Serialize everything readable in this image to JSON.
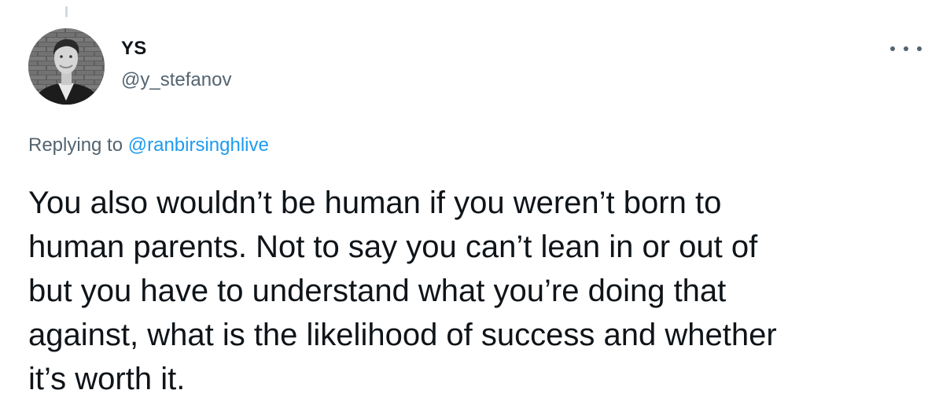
{
  "author": {
    "display_name": "YS",
    "handle": "@y_stefanov",
    "avatar_icon": "profile-photo"
  },
  "more_icon": "more-horizontal-icon",
  "reply_context": {
    "prefix": "Replying to",
    "mention": "@ranbirsinghlive"
  },
  "tweet": {
    "text": "You also wouldn’t be human if you weren’t born to\nhuman parents. Not to say you can’t lean in or out of\nbut you have to understand what you’re doing that\nagainst, what is the likelihood of success and whether\nit’s worth it."
  },
  "colors": {
    "text_primary": "#0f1419",
    "text_secondary": "#536471",
    "link": "#1d9bf0"
  }
}
